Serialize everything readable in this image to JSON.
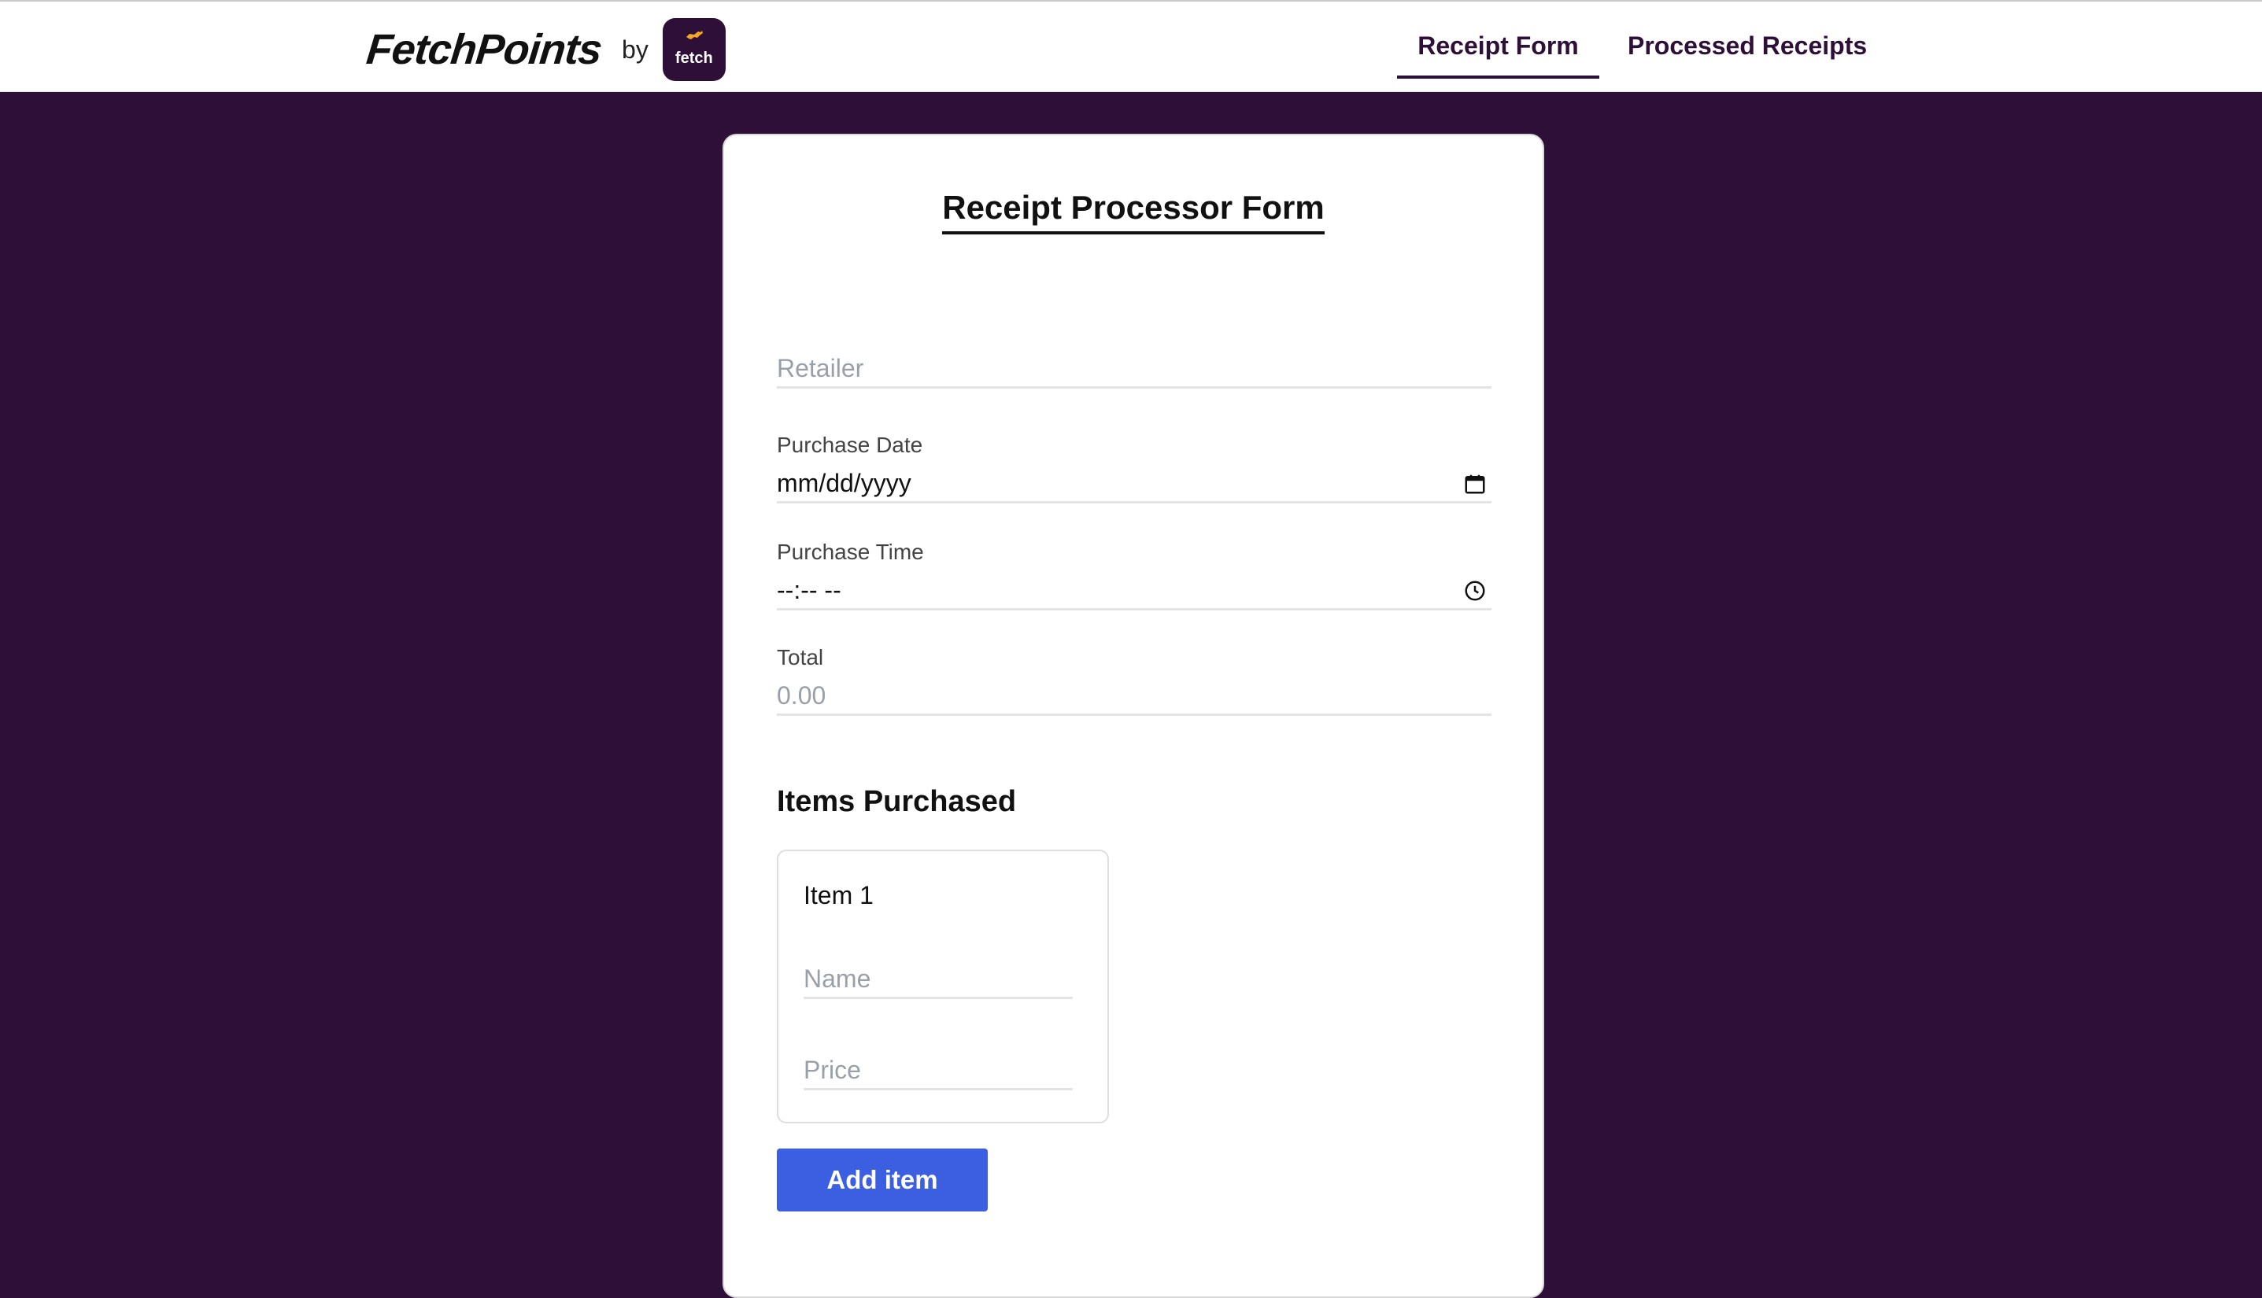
{
  "header": {
    "brand_name": "FetchPoints",
    "brand_by": "by",
    "badge_text": "fetch",
    "nav": {
      "receipt_form": "Receipt Form",
      "processed_receipts": "Processed Receipts"
    },
    "active_tab": "receipt_form"
  },
  "form": {
    "title": "Receipt Processor Form",
    "retailer": {
      "placeholder": "Retailer"
    },
    "purchase_date": {
      "label": "Purchase Date",
      "value": "mm/dd/yyyy",
      "icon": "calendar-icon"
    },
    "purchase_time": {
      "label": "Purchase Time",
      "value": "--:-- --",
      "icon": "clock-icon"
    },
    "total": {
      "label": "Total",
      "placeholder": "0.00"
    },
    "items_section_title": "Items Purchased",
    "items": [
      {
        "title": "Item 1",
        "name_placeholder": "Name",
        "price_placeholder": "Price"
      }
    ],
    "add_item_label": "Add item"
  },
  "colors": {
    "background": "#2d0f37",
    "accent_button": "#3b5fe0",
    "card": "#ffffff"
  }
}
